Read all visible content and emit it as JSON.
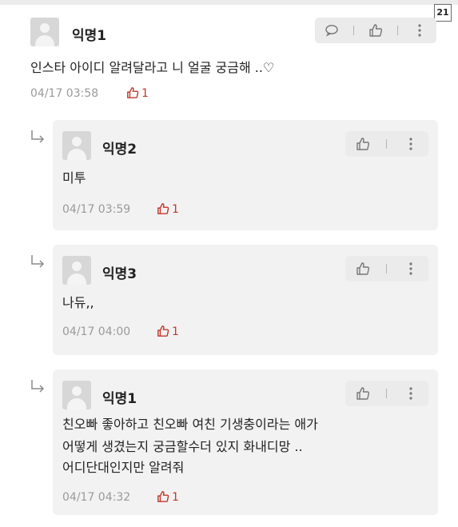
{
  "page_badge": "21",
  "comments": [
    {
      "author": "익명1",
      "text": [
        "인스타 아이디 알려달라고 니 얼굴 궁금해 ..♡"
      ],
      "time": "04/17 03:58",
      "likes": "1"
    },
    {
      "author": "익명2",
      "text": [
        "미투"
      ],
      "time": "04/17 03:59",
      "likes": "1"
    },
    {
      "author": "익명3",
      "text": [
        "나듀,,"
      ],
      "time": "04/17 04:00",
      "likes": "1"
    },
    {
      "author": "익명1",
      "text": [
        "친오빠 좋아하고 친오빠 여친 기생충이라는 애가",
        "어떻게 생겼는지 궁금할수더 있지 화내디망 ..",
        "어디단대인지만 알려줘"
      ],
      "time": "04/17 04:32",
      "likes": "1"
    }
  ],
  "colors": {
    "like_accent": "#c0392b",
    "card_bg": "#f2f2f2",
    "meta_text": "#9a9a9a"
  },
  "icons": [
    "chat-bubble-icon",
    "thumbs-up-icon",
    "more-vertical-icon",
    "reply-arrow-icon",
    "avatar-placeholder-icon"
  ]
}
